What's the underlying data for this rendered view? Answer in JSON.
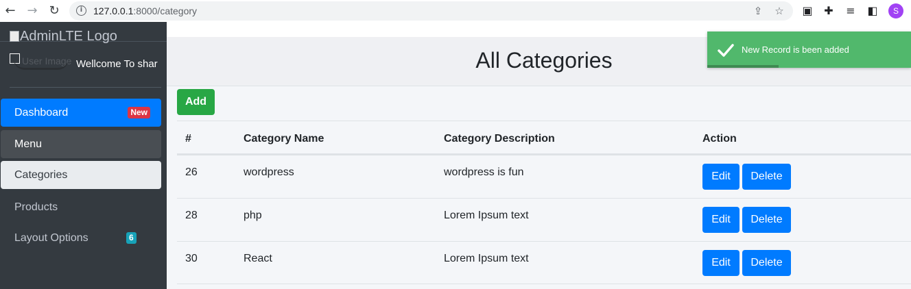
{
  "browser": {
    "url_host": "127.0.0.1",
    "url_rest": ":8000/category",
    "profile_initial": "S"
  },
  "sidebar": {
    "brand_text": "AdminLTE Logo",
    "user_image_alt": "User Image",
    "user_name": "Wellcome To shar",
    "items": [
      {
        "label": "Dashboard",
        "badge": "New",
        "state": "active"
      },
      {
        "label": "Menu",
        "state": "open"
      },
      {
        "label": "Categories",
        "state": "sub-active"
      },
      {
        "label": "Products",
        "state": "normal"
      },
      {
        "label": "Layout Options",
        "badge": "6",
        "state": "normal"
      }
    ]
  },
  "main": {
    "title": "All Categories",
    "add_label": "Add",
    "columns": [
      "#",
      "Category Name",
      "Category Description",
      "Action"
    ],
    "rows": [
      {
        "id": "26",
        "name": "wordpress",
        "description": "wordpress is fun",
        "edit": "Edit",
        "delete": "Delete"
      },
      {
        "id": "28",
        "name": "php",
        "description": "Lorem Ipsum text",
        "edit": "Edit",
        "delete": "Delete"
      },
      {
        "id": "30",
        "name": "React",
        "description": "Lorem Ipsum text",
        "edit": "Edit",
        "delete": "Delete"
      }
    ]
  },
  "toast": {
    "message": "New Record is been added",
    "progress": 0.35
  },
  "colors": {
    "sidebar": "#343a40",
    "primary": "#007bff",
    "success": "#28a745",
    "danger": "#dc3545",
    "info": "#17a2b8",
    "toast": "#51b86c"
  }
}
